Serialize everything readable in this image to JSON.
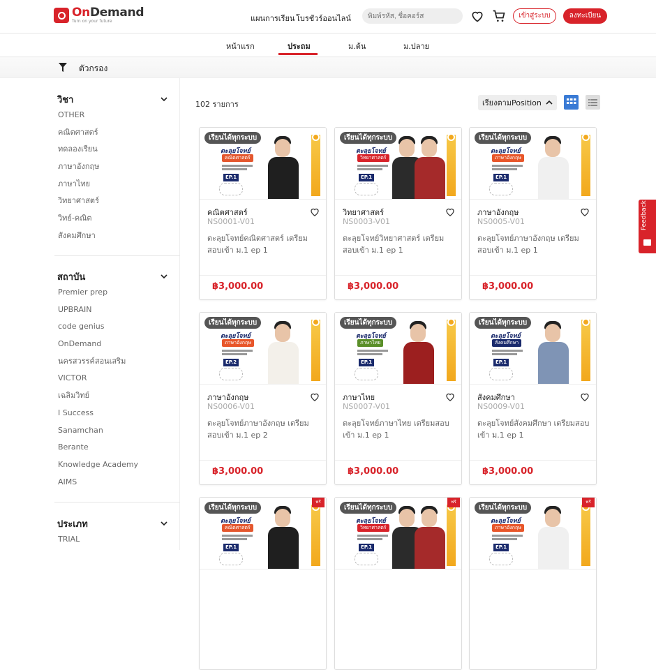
{
  "header": {
    "logo_on": "On",
    "logo_demand": "Demand",
    "logo_tagline": "Turn on your future",
    "nav_study_plan": "แผนการเรียน",
    "nav_online_brochure": "โบรชัวร์ออนไลน์",
    "search_placeholder": "พิมพ์รหัส, ชื่อคอร์ส",
    "login_label": "เข้าสู่ระบบ",
    "register_label": "ลงทะเบียน"
  },
  "tabs": [
    {
      "label": "หน้าแรก",
      "active": false
    },
    {
      "label": "ประถม",
      "active": true
    },
    {
      "label": "ม.ต้น",
      "active": false
    },
    {
      "label": "ม.ปลาย",
      "active": false
    }
  ],
  "filter": {
    "label": "ตัวกรอง"
  },
  "sidebar": {
    "subject": {
      "title": "วิชา",
      "items": [
        "OTHER",
        "คณิตศาสตร์",
        "ทดลองเรียน",
        "ภาษาอังกฤษ",
        "ภาษาไทย",
        "วิทยาศาสตร์",
        "วิทย์-คณิต",
        "สังคมศึกษา"
      ]
    },
    "institute": {
      "title": "สถาบัน",
      "items": [
        "Premier prep",
        "UPBRAIN",
        "code genius",
        "OnDemand",
        "นครสวรรค์สอนเสริม",
        "VICTOR",
        "เฉลิมวิทย์",
        "I Success",
        "Sanamchan",
        "Berante",
        "Knowledge Academy",
        "AIMS"
      ]
    },
    "type": {
      "title": "ประเภท",
      "items": [
        "TRIAL"
      ]
    }
  },
  "main": {
    "count": "102 รายการ",
    "sort_label": "เรียงตามPosition"
  },
  "cards": [
    {
      "badge": "เรียนได้ทุกระบบ",
      "brand": "ตะลุยโจทย์",
      "tag": "คณิตศาสตร์",
      "ep": "EP.1",
      "subject": "คณิตศาสตร์",
      "code": "NS0001-V01",
      "desc": "ตะลุยโจทย์คณิตศาสตร์ เตรียมสอบเข้า ม.1 ep 1",
      "price": "฿3,000.00"
    },
    {
      "badge": "เรียนได้ทุกระบบ",
      "brand": "ตะลุยโจทย์",
      "tag": "วิทยาศาสตร์",
      "ep": "EP.1",
      "subject": "วิทยาศาสตร์",
      "code": "NS0003-V01",
      "desc": "ตะลุยโจทย์วิทยาศาสตร์ เตรียมสอบเข้า ม.1 ep 1",
      "price": "฿3,000.00"
    },
    {
      "badge": "เรียนได้ทุกระบบ",
      "brand": "ตะลุยโจทย์",
      "tag": "ภาษาอังกฤษ",
      "ep": "EP.1",
      "subject": "ภาษาอังกฤษ",
      "code": "NS0005-V01",
      "desc": "ตะลุยโจทย์ภาษาอังกฤษ เตรียมสอบเข้า ม.1 ep 1",
      "price": "฿3,000.00"
    },
    {
      "badge": "เรียนได้ทุกระบบ",
      "brand": "ตะลุยโจทย์",
      "tag": "ภาษาอังกฤษ",
      "ep": "EP.2",
      "subject": "ภาษาอังกฤษ",
      "code": "NS0006-V01",
      "desc": "ตะลุยโจทย์ภาษาอังกฤษ เตรียมสอบเข้า ม.1 ep 2",
      "price": "฿3,000.00"
    },
    {
      "badge": "เรียนได้ทุกระบบ",
      "brand": "ตะลุยโจทย์",
      "tag": "ภาษาไทย",
      "ep": "EP.1",
      "subject": "ภาษาไทย",
      "code": "NS0007-V01",
      "desc": "ตะลุยโจทย์ภาษาไทย เตรียมสอบเข้า ม.1 ep 1",
      "price": "฿3,000.00"
    },
    {
      "badge": "เรียนได้ทุกระบบ",
      "brand": "ตะลุยโจทย์",
      "tag": "สังคมศึกษา",
      "ep": "EP.1",
      "subject": "สังคมศึกษา",
      "code": "NS0009-V01",
      "desc": "ตะลุยโจทย์สังคมศึกษา เตรียมสอบเข้า ม.1 ep 1",
      "price": "฿3,000.00"
    },
    {
      "badge": "เรียนได้ทุกระบบ",
      "brand": "ตะลุยโจทย์",
      "tag": "คณิตศาสตร์",
      "ep": "EP.1",
      "free": "ฟรี"
    },
    {
      "badge": "เรียนได้ทุกระบบ",
      "brand": "ตะลุยโจทย์",
      "tag": "วิทยาศาสตร์",
      "ep": "EP.1",
      "free": "ฟรี"
    },
    {
      "badge": "เรียนได้ทุกระบบ",
      "brand": "ตะลุยโจทย์",
      "tag": "ภาษาอังกฤษ",
      "ep": "EP.1",
      "free": "ฟรี"
    }
  ],
  "feedback": {
    "label": "Feedback"
  },
  "colors": {
    "accent": "#d8232a",
    "grid_active": "#3a7bd5",
    "strip": "#f2a81d"
  }
}
